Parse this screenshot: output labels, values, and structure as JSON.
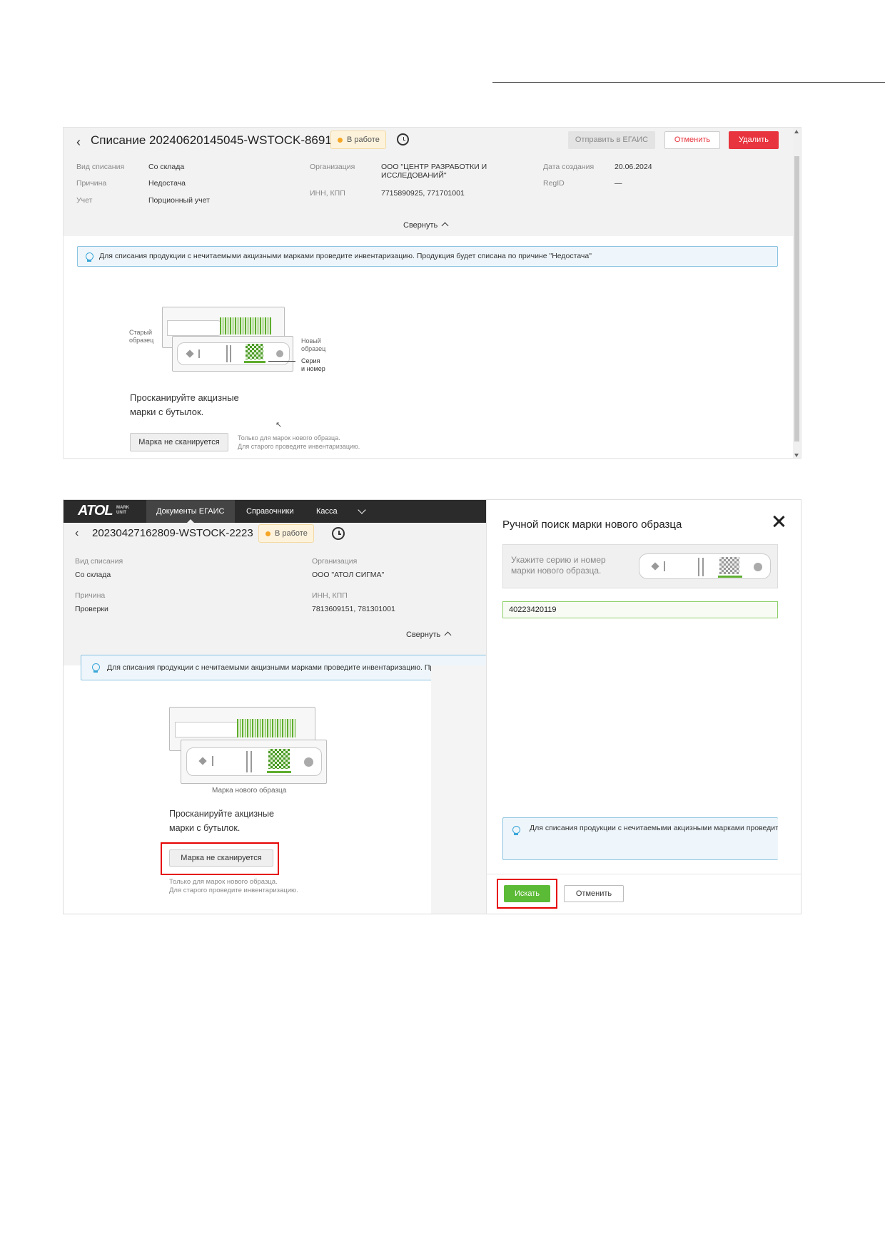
{
  "screen1": {
    "title": "Списание 20240620145045-WSTOCK-8691",
    "status": "В работе",
    "buttons": {
      "send_egais": "Отправить в ЕГАИС",
      "cancel": "Отменить",
      "delete": "Удалить"
    },
    "fields": {
      "writeoff_type_label": "Вид списания",
      "writeoff_type_value": "Со склада",
      "reason_label": "Причина",
      "reason_value": "Недостача",
      "accounting_label": "Учет",
      "accounting_value": "Порционный учет",
      "org_label": "Организация",
      "org_value": "ООО \"ЦЕНТР РАЗРАБОТКИ И ИССЛЕДОВАНИЙ\"",
      "inn_label": "ИНН, КПП",
      "inn_value": "7715890925, 771701001",
      "created_label": "Дата создания",
      "created_value": "20.06.2024",
      "regid_label": "RegID",
      "regid_value": "—"
    },
    "collapse": "Свернуть",
    "info": "Для списания продукции с нечитаемыми акцизными марками проведите инвентаризацию. Продукция будет списана по причине \"Недостача\"",
    "illustration": {
      "old_label_1": "Старый",
      "old_label_2": "образец",
      "new_label_1": "Новый",
      "new_label_2": "образец",
      "series_label_1": "Серия",
      "series_label_2": "и номер"
    },
    "scan_text_1": "Просканируйте акцизные",
    "scan_text_2": "марки с бутылок.",
    "no_scan_button": "Марка не сканируется",
    "hint_1": "Только для марок нового образца.",
    "hint_2": "Для старого проведите инвентаризацию."
  },
  "screen2": {
    "nav": {
      "logo": "ATOL",
      "logo_sub_1": "MARK",
      "logo_sub_2": "UNIT",
      "tabs": [
        "Документы ЕГАИС",
        "Справочники",
        "Касса"
      ]
    },
    "title": "20230427162809-WSTOCK-2223",
    "status": "В работе",
    "fields": {
      "writeoff_type_label": "Вид списания",
      "writeoff_type_value": "Со склада",
      "reason_label": "Причина",
      "reason_value": "Проверки",
      "org_label": "Организация",
      "org_value": "ООО \"АТОЛ СИГМА\"",
      "inn_label": "ИНН, КПП",
      "inn_value": "7813609151, 781301001"
    },
    "collapse": "Свернуть",
    "info": "Для списания продукции с нечитаемыми акцизными марками проведите инвентаризацию. Продукция",
    "illustration_caption": "Марка нового образца",
    "scan_text_1": "Просканируйте акцизные",
    "scan_text_2": "марки с бутылок.",
    "no_scan_button": "Марка не сканируется",
    "hint_1": "Только для марок нового образца.",
    "hint_2": "Для старого проведите инвентаризацию.",
    "panel": {
      "title": "Ручной поиск марки нового образца",
      "help_1": "Укажите серию и номер",
      "help_2": "марки нового образца.",
      "search_value": "40223420119",
      "info": "Для списания продукции с нечитаемыми акцизными марками проведите инвентаризацию. Продукция будет списана по причине \"Недостача\"",
      "search_button": "Искать",
      "cancel_button": "Отменить"
    }
  },
  "colors": {
    "status_dot": "#f5a623",
    "danger": "#e8343e",
    "success": "#5cbb36",
    "highlight": "#e60000",
    "info_border": "#8cc3e0"
  },
  "icons": [
    "back-arrow-icon",
    "history-clock-icon",
    "lightbulb-icon",
    "close-icon",
    "chevron-up-icon",
    "chevron-down-icon"
  ]
}
